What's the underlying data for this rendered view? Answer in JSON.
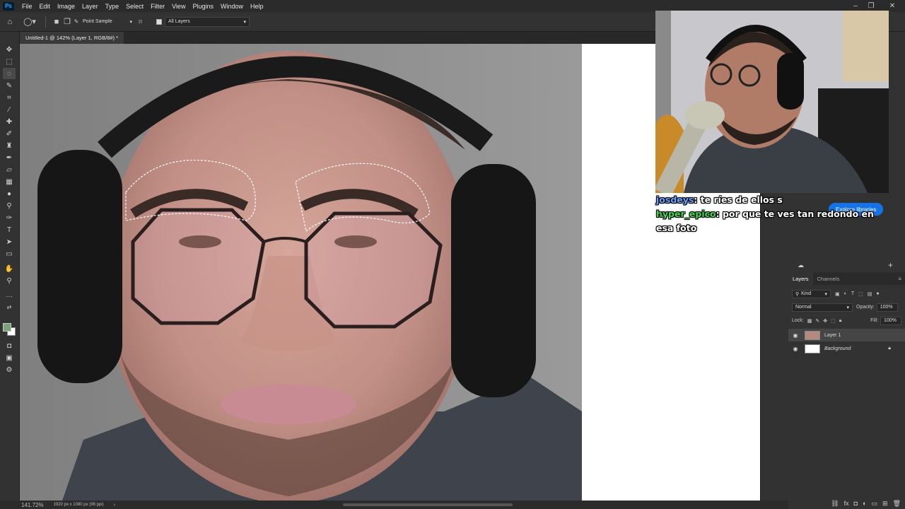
{
  "app": {
    "logo": "Ps",
    "menus": [
      "File",
      "Edit",
      "Image",
      "Layer",
      "Type",
      "Select",
      "Filter",
      "View",
      "Plugins",
      "Window",
      "Help"
    ]
  },
  "options_bar": {
    "sample_size": "Point Sample",
    "sample_layers": "All Layers"
  },
  "document": {
    "tab_title": "Untitled-1 @ 142% (Layer 1, RGB/8#) *"
  },
  "status_bar": {
    "zoom": "141.72%",
    "doc_info": "1920 px x 1080 px (96 ppi)"
  },
  "libraries": {
    "explore_button": "Explore libraries"
  },
  "layers_panel": {
    "tabs": [
      "Layers",
      "Channels"
    ],
    "filter_kind": "Kind",
    "blend_mode": "Normal",
    "opacity_label": "Opacity:",
    "opacity_value": "100%",
    "lock_label": "Lock:",
    "fill_label": "Fill:",
    "fill_value": "100%",
    "layers": [
      {
        "name": "Layer 1",
        "selected": true
      },
      {
        "name": "Background",
        "selected": false,
        "locked": true
      }
    ]
  },
  "chat": {
    "messages": [
      {
        "user": "josdeys",
        "text": "te ríes de ellos s"
      },
      {
        "user": "hyper_epico",
        "text": "por que te ves tan redondo en esa foto"
      }
    ]
  },
  "colors": {
    "foreground": "#7aa37a",
    "background": "#ffffff",
    "accent": "#1473e6"
  }
}
